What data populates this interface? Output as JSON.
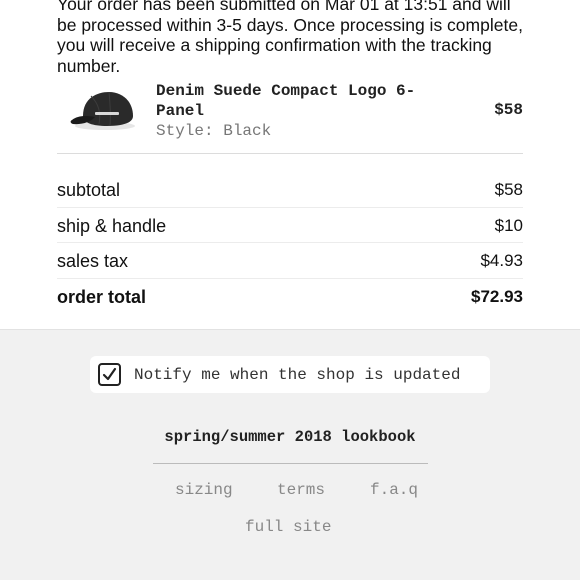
{
  "order": {
    "message": "Your order has been submitted on Mar 01 at 13:51 and will be processed within 3-5 days. Once processing is complete, you will receive a shipping confirmation with the tracking number."
  },
  "product": {
    "name": "Denim Suede Compact Logo 6-Panel",
    "style": "Style: Black",
    "price": "$58",
    "image_icon": "black-cap-icon"
  },
  "summary": [
    {
      "label": "subtotal",
      "value": "$58"
    },
    {
      "label": "ship & handle",
      "value": "$10"
    },
    {
      "label": "sales tax",
      "value": "$4.93"
    },
    {
      "label": "order total",
      "value": "$72.93"
    }
  ],
  "notify": {
    "label": "Notify me when the shop is updated",
    "checked": true
  },
  "footer": {
    "lookbook": "spring/summer 2018 lookbook",
    "links": [
      "sizing",
      "terms",
      "f.a.q",
      "full site"
    ]
  },
  "colors": {
    "background": "#f1f1f1",
    "card": "#ffffff",
    "muted_text": "#888888"
  }
}
